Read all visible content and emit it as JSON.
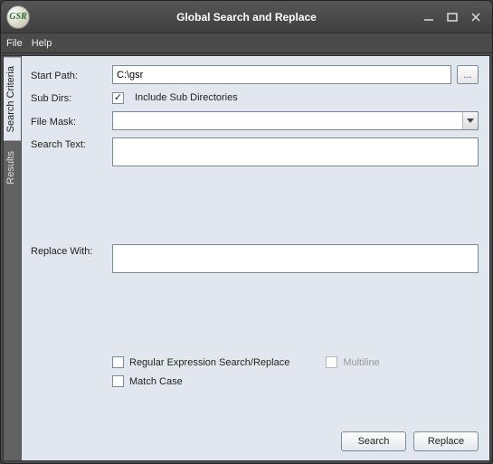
{
  "window": {
    "title": "Global Search and Replace",
    "icon_text": "GSR"
  },
  "menu": {
    "file": "File",
    "help": "Help"
  },
  "tabs": {
    "search_criteria": "Search Criteria",
    "results": "Results"
  },
  "labels": {
    "start_path": "Start Path:",
    "sub_dirs": "Sub Dirs:",
    "file_mask": "File Mask:",
    "search_text": "Search Text:",
    "replace_with": "Replace With:"
  },
  "fields": {
    "start_path_value": "C:\\gsr",
    "include_sub_dirs_label": "Include Sub Directories",
    "include_sub_dirs_checked": true,
    "file_mask_value": "",
    "search_text_value": "",
    "replace_with_value": ""
  },
  "options": {
    "regex_label": "Regular Expression Search/Replace",
    "regex_checked": false,
    "multiline_label": "Multiline",
    "multiline_checked": false,
    "multiline_enabled": false,
    "match_case_label": "Match Case",
    "match_case_checked": false
  },
  "buttons": {
    "browse": "...",
    "search": "Search",
    "replace": "Replace"
  }
}
